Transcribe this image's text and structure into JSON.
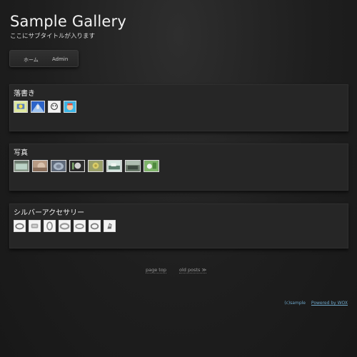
{
  "header": {
    "title": "Sample Gallery",
    "subtitle": "ここにサブタイトルが入ります"
  },
  "nav": {
    "home": "ホーム",
    "admin": "Admin"
  },
  "sections": [
    {
      "title": "落書き",
      "thumb_count": 4
    },
    {
      "title": "写真",
      "thumb_count": 8
    },
    {
      "title": "シルバーアクセサリー",
      "thumb_count": 7
    }
  ],
  "pager": {
    "page_top": "page top",
    "old_posts": "old posts ≫"
  },
  "footer": {
    "copyright": "(c)sample",
    "powered": "Powered by WOX"
  }
}
